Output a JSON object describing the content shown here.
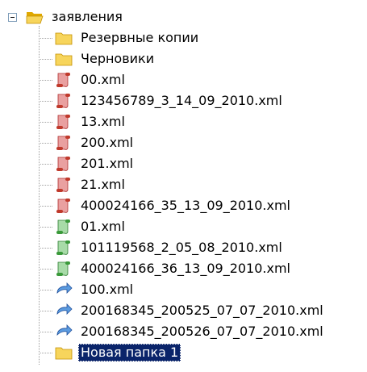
{
  "tree": {
    "root": {
      "label": "заявления",
      "icon": "folder-open-icon",
      "expanded": true
    },
    "children": [
      {
        "label": "Резервные копии",
        "icon": "folder-icon"
      },
      {
        "label": "Черновики",
        "icon": "folder-icon"
      },
      {
        "label": "00.xml",
        "icon": "red-scroll-icon"
      },
      {
        "label": "123456789_3_14_09_2010.xml",
        "icon": "red-scroll-icon"
      },
      {
        "label": "13.xml",
        "icon": "red-scroll-icon"
      },
      {
        "label": "200.xml",
        "icon": "red-scroll-icon"
      },
      {
        "label": "201.xml",
        "icon": "red-scroll-icon"
      },
      {
        "label": "21.xml",
        "icon": "red-scroll-icon"
      },
      {
        "label": "400024166_35_13_09_2010.xml",
        "icon": "red-scroll-icon"
      },
      {
        "label": "01.xml",
        "icon": "green-scroll-icon"
      },
      {
        "label": "101119568_2_05_08_2010.xml",
        "icon": "green-scroll-icon"
      },
      {
        "label": "400024166_36_13_09_2010.xml",
        "icon": "green-scroll-icon"
      },
      {
        "label": "100.xml",
        "icon": "blue-arrow-icon"
      },
      {
        "label": "200168345_200525_07_07_2010.xml",
        "icon": "blue-arrow-icon"
      },
      {
        "label": "200168345_200526_07_07_2010.xml",
        "icon": "blue-arrow-icon"
      },
      {
        "label": "Новая папка 1",
        "icon": "folder-icon",
        "selected": true
      }
    ]
  },
  "colors": {
    "selection_bg": "#0a246a",
    "selection_fg": "#ffffff",
    "folder": "#f2c94c",
    "red_scroll": "#c0392b",
    "green_scroll": "#3a9a3a",
    "blue_arrow": "#2f6fc4"
  }
}
